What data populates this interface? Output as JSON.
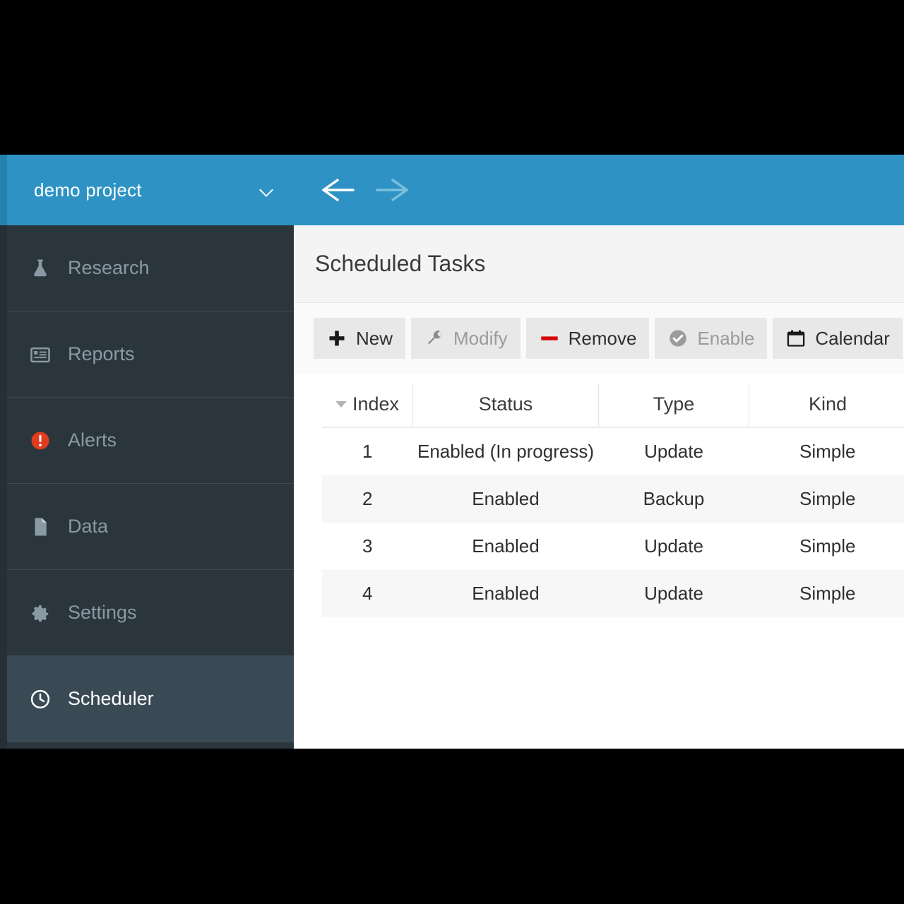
{
  "sidebar": {
    "project": {
      "name": "demo project",
      "chevron_icon": "chevron-down-icon"
    },
    "items": [
      {
        "label": "Research",
        "icon": "flask-icon",
        "active": false
      },
      {
        "label": "Reports",
        "icon": "list-icon",
        "active": false
      },
      {
        "label": "Alerts",
        "icon": "alert-icon",
        "active": false
      },
      {
        "label": "Data",
        "icon": "document-icon",
        "active": false
      },
      {
        "label": "Settings",
        "icon": "gear-icon",
        "active": false
      },
      {
        "label": "Scheduler",
        "icon": "clock-icon",
        "active": true
      }
    ]
  },
  "topbar": {
    "back_icon": "arrow-left-icon",
    "forward_icon": "arrow-right-icon",
    "back_enabled": true,
    "forward_enabled": false
  },
  "main": {
    "title": "Scheduled Tasks",
    "toolbar": [
      {
        "label": "New",
        "icon": "plus-icon",
        "disabled": false
      },
      {
        "label": "Modify",
        "icon": "wrench-icon",
        "disabled": true
      },
      {
        "label": "Remove",
        "icon": "minus-icon",
        "disabled": false
      },
      {
        "label": "Enable",
        "icon": "check-circle-icon",
        "disabled": true
      },
      {
        "label": "Calendar",
        "icon": "calendar-icon",
        "disabled": false
      }
    ],
    "table": {
      "columns": [
        "Index",
        "Status",
        "Type",
        "Kind"
      ],
      "sort": {
        "column": "Index",
        "direction": "descending"
      },
      "rows": [
        {
          "index": "1",
          "status": "Enabled (In progress)",
          "type": "Update",
          "kind": "Simple"
        },
        {
          "index": "2",
          "status": "Enabled",
          "type": "Backup",
          "kind": "Simple"
        },
        {
          "index": "3",
          "status": "Enabled",
          "type": "Update",
          "kind": "Simple"
        },
        {
          "index": "4",
          "status": "Enabled",
          "type": "Update",
          "kind": "Simple"
        }
      ]
    }
  },
  "colors": {
    "accent_blue": "#2e93c4",
    "sidebar_bg": "#2b353c",
    "sidebar_active": "#3a4a55",
    "status_green": "#33cc33",
    "alert_red": "#e03c1f",
    "remove_red": "#d60000"
  }
}
